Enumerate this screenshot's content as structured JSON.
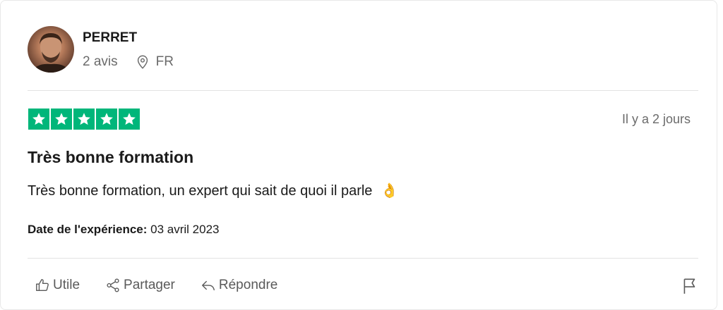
{
  "reviewer": {
    "name": "PERRET",
    "review_count": "2 avis",
    "country": "FR"
  },
  "review": {
    "rating": 5,
    "max_rating": 5,
    "date_ago": "Il y a 2 jours",
    "title": "Très bonne formation",
    "body": "Très bonne formation, un expert qui sait de quoi il parle",
    "emoji": "👌",
    "experience_label": "Date de l'expérience:",
    "experience_date": "03 avril 2023"
  },
  "actions": {
    "useful": "Utile",
    "share": "Partager",
    "reply": "Répondre"
  },
  "icons": [
    "avatar",
    "location-pin-icon",
    "star-icon",
    "thumbs-up-icon",
    "share-icon",
    "reply-icon",
    "flag-icon"
  ],
  "colors": {
    "star_green": "#00b67a",
    "text_primary": "#1a1a1a",
    "text_muted": "#6b6b6b"
  }
}
